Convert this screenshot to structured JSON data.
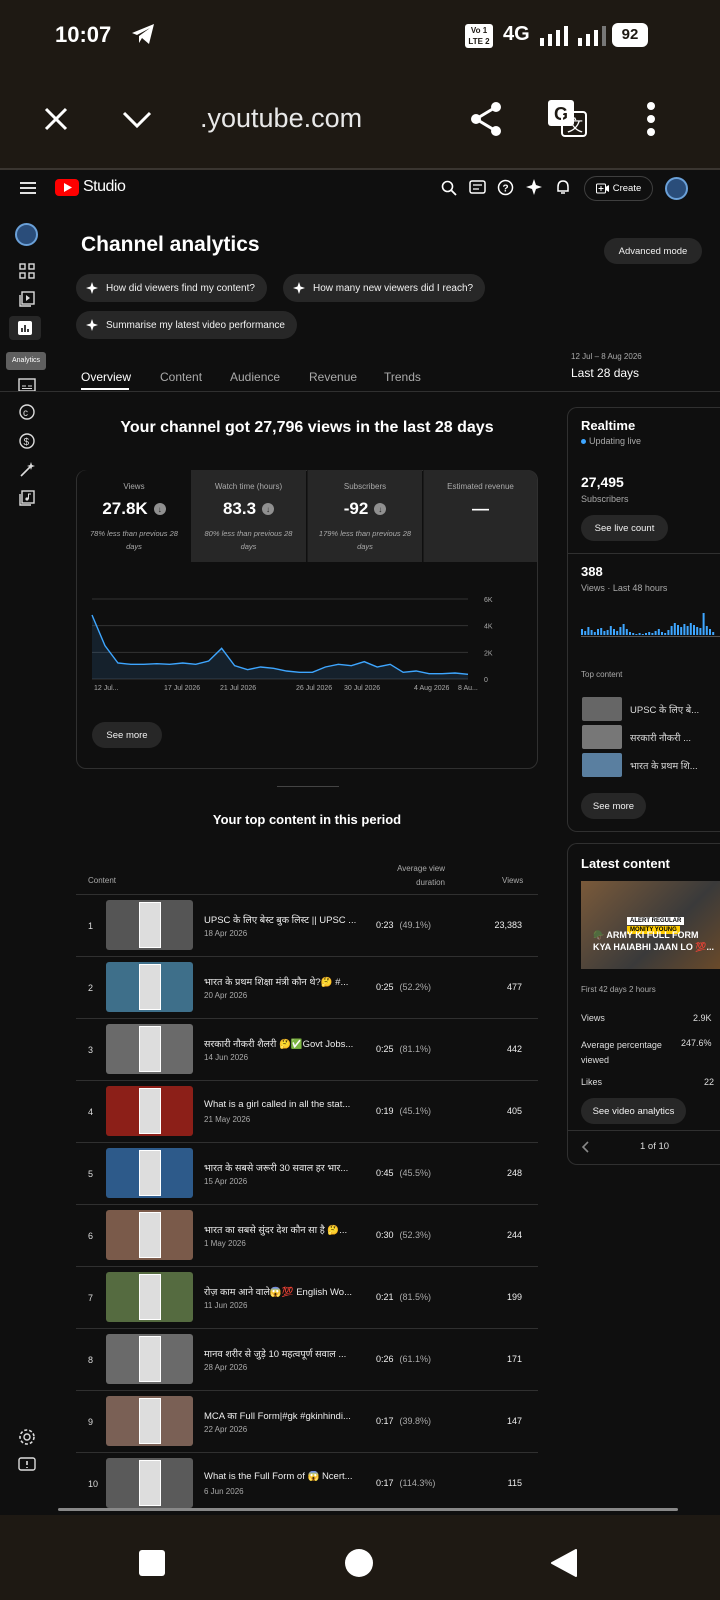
{
  "status": {
    "time": "10:07",
    "network": "4G",
    "volte_top": "Vo 1",
    "volte_bottom": "LTE 2",
    "battery": "92"
  },
  "browser": {
    "url": ".youtube.com"
  },
  "header": {
    "logo_text": "Studio",
    "create_label": "Create"
  },
  "sidebar": {
    "tooltip": "Analytics"
  },
  "page": {
    "title": "Channel analytics",
    "advanced_label": "Advanced mode"
  },
  "chips": [
    "How did viewers find my content?",
    "How many new viewers did I reach?",
    "Summarise my latest video performance"
  ],
  "tabs": [
    "Overview",
    "Content",
    "Audience",
    "Revenue",
    "Trends"
  ],
  "date_range": {
    "range": "12 Jul – 8 Aug 2026",
    "label": "Last 28 days"
  },
  "summary_headline": "Your channel got 27,796 views in the last 28 days",
  "kpis": [
    {
      "label": "Views",
      "value": "27.8K",
      "change": "78% less than previous 28 days"
    },
    {
      "label": "Watch time (hours)",
      "value": "83.3",
      "change": "80% less than previous 28 days"
    },
    {
      "label": "Subscribers",
      "value": "-92",
      "change": "179% less than previous 28 days"
    },
    {
      "label": "Estimated revenue",
      "value": "—",
      "change": ""
    }
  ],
  "chart_data": {
    "type": "line",
    "series": [
      {
        "name": "Views",
        "values": [
          4800,
          2500,
          1200,
          1100,
          1100,
          1150,
          1100,
          1200,
          1100,
          1350,
          2300,
          1000,
          700,
          900,
          800,
          600,
          500,
          500,
          900,
          1100,
          1000,
          1300,
          900,
          1100,
          500,
          600,
          400,
          400,
          450,
          350
        ]
      }
    ],
    "ylim": [
      0,
      6000
    ],
    "yticks": [
      "6K",
      "4K",
      "2K",
      "0"
    ],
    "xticks": [
      "12 Jul...",
      "17 Jul 2026",
      "21 Jul 2026",
      "26 Jul 2026",
      "30 Jul 2026",
      "4 Aug 2026",
      "8 Au..."
    ]
  },
  "see_more": "See more",
  "top_content": {
    "title": "Your top content in this period",
    "col_content": "Content",
    "col_avd_1": "Average view",
    "col_avd_2": "duration",
    "col_views": "Views",
    "rows": [
      {
        "rank": "1",
        "title": "UPSC के लिए बेस्ट बुक लिस्ट || UPSC ...",
        "date": "18 Apr 2026",
        "avd": "0:23",
        "pct": "(49.1%)",
        "views": "23,383",
        "color": "#555555"
      },
      {
        "rank": "2",
        "title": "भारत के प्रथम शिक्षा मंत्री कौन थे?🤔 #...",
        "date": "20 Apr 2026",
        "avd": "0:25",
        "pct": "(52.2%)",
        "views": "477",
        "color": "#3e6f8a"
      },
      {
        "rank": "3",
        "title": "सरकारी नौकरी शैलरी 🤔✅Govt Jobs...",
        "date": "14 Jun 2026",
        "avd": "0:25",
        "pct": "(81.1%)",
        "views": "442",
        "color": "#6a6a6a"
      },
      {
        "rank": "4",
        "title": "What is a girl called in all the stat...",
        "date": "21 May 2026",
        "avd": "0:19",
        "pct": "(45.1%)",
        "views": "405",
        "color": "#8c1f18"
      },
      {
        "rank": "5",
        "title": "भारत के सबसे जरूरी 30 सवाल हर भार...",
        "date": "15 Apr 2026",
        "avd": "0:45",
        "pct": "(45.5%)",
        "views": "248",
        "color": "#2d5a8a"
      },
      {
        "rank": "6",
        "title": "भारत का सबसे सुंदर देश कौन सा है 🤔...",
        "date": "1 May 2026",
        "avd": "0:30",
        "pct": "(52.3%)",
        "views": "244",
        "color": "#7a5a4a"
      },
      {
        "rank": "7",
        "title": "रोज़ काम आने वाले😱💯 English Wo...",
        "date": "11 Jun 2026",
        "avd": "0:21",
        "pct": "(81.5%)",
        "views": "199",
        "color": "#556b40"
      },
      {
        "rank": "8",
        "title": "मानव शरीर से जुड़े 10 महत्वपूर्ण सवाल ...",
        "date": "28 Apr 2026",
        "avd": "0:26",
        "pct": "(61.1%)",
        "views": "171",
        "color": "#6a6a6a"
      },
      {
        "rank": "9",
        "title": "MCA का Full Form|#gk #gkinhindi...",
        "date": "22 Apr 2026",
        "avd": "0:17",
        "pct": "(39.8%)",
        "views": "147",
        "color": "#7a6055"
      },
      {
        "rank": "10",
        "title": "What is the Full Form of 😱 Ncert...",
        "date": "6 Jun 2026",
        "avd": "0:17",
        "pct": "(114.3%)",
        "views": "115",
        "color": "#5a5a5a"
      }
    ]
  },
  "realtime": {
    "title": "Realtime",
    "status": "Updating live",
    "subs": "27,495",
    "subs_label": "Subscribers",
    "live_btn": "See live count",
    "views": "388",
    "views_label": "Views · Last 48 hours",
    "top_content": "Top content",
    "items": [
      "UPSC के लिए बे...",
      "सरकारी नौकरी ...",
      "भारत के प्रथम शि..."
    ],
    "see_more": "See more"
  },
  "latest": {
    "title": "Latest content",
    "thumb_tag_1": "ALERT REGULAR",
    "thumb_tag_2": "MONITY YOUNG",
    "video_title": "🪖 ARMY KI FULL FORM KYA HAIABHI JAAN LO 💯...",
    "period": "First 42 days 2 hours",
    "views_label": "Views",
    "views_val": "2.9K",
    "avg_label": "Average percentage viewed",
    "avg_val": "247.6%",
    "likes_label": "Likes",
    "likes_val": "22",
    "btn": "See video analytics",
    "pager": "1 of 10"
  }
}
